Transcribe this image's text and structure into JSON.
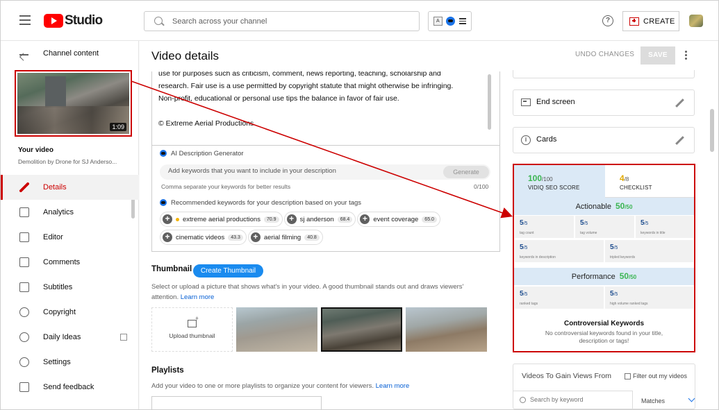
{
  "topbar": {
    "logo_text": "Studio",
    "search_placeholder": "Search across your channel",
    "create_label": "CREATE",
    "help_symbol": "?",
    "ext_a": "A"
  },
  "sidebar": {
    "back_label": "Channel content",
    "thumbnail_duration": "1:09",
    "your_video_label": "Your video",
    "video_name": "Demolition by Drone for SJ Anderso...",
    "items": [
      {
        "label": "Details",
        "icon": "pencil-icon",
        "active": true
      },
      {
        "label": "Analytics",
        "icon": "analytics-icon"
      },
      {
        "label": "Editor",
        "icon": "editor-icon"
      },
      {
        "label": "Comments",
        "icon": "comments-icon"
      },
      {
        "label": "Subtitles",
        "icon": "subtitles-icon"
      },
      {
        "label": "Copyright",
        "icon": "copyright-icon"
      },
      {
        "label": "Daily Ideas",
        "icon": "daily-ideas-icon"
      },
      {
        "label": "Settings",
        "icon": "settings-icon"
      },
      {
        "label": "Send feedback",
        "icon": "feedback-icon"
      }
    ]
  },
  "main": {
    "title": "Video details",
    "undo_label": "UNDO CHANGES",
    "save_label": "SAVE",
    "description": {
      "line1": "use  for purposes such as criticism, comment, news reporting, teaching, scholarship and",
      "line2": "research. Fair use is a use permitted by copyright statute that might otherwise be infringing.",
      "line3": "Non-profit, educational or personal use tips the balance in favor of fair use.",
      "line4": "",
      "line5": "© Extreme Aerial Productions"
    },
    "ai": {
      "title": "AI Description Generator",
      "input_placeholder": "Add keywords that you want to include in your description",
      "generate_label": "Generate",
      "hint": "Comma separate your keywords for better results",
      "count": "0/100",
      "recommended_title": "Recommended keywords for your description based on your tags",
      "keywords": [
        {
          "text": "extreme aerial productions",
          "score": "70.9",
          "dot": true
        },
        {
          "text": "sj anderson",
          "score": "68.4"
        },
        {
          "text": "event coverage",
          "score": "65.0"
        },
        {
          "text": "cinematic videos",
          "score": "43.3"
        },
        {
          "text": "aerial filming",
          "score": "40.8"
        }
      ]
    },
    "thumbnail": {
      "title": "Thumbnail",
      "create_label": "Create Thumbnail",
      "desc": "Select or upload a picture that shows what's in your video. A good thumbnail stands out and draws viewers' attention.",
      "learn_more": "Learn more",
      "upload_label": "Upload thumbnail"
    },
    "playlists": {
      "title": "Playlists",
      "desc": "Add your video to one or more playlists to organize your content for viewers.",
      "learn_more": "Learn more"
    }
  },
  "right": {
    "end_screen_label": "End screen",
    "cards_label": "Cards",
    "vidiq": {
      "seo_score": "100",
      "seo_max": "/100",
      "seo_label": "VIDIQ SEO SCORE",
      "checklist_score": "4",
      "checklist_max": "/8",
      "checklist_label": "CHECKLIST",
      "actionable_label": "Actionable",
      "actionable_score": "50",
      "actionable_max": "/50",
      "actionable_cells": [
        {
          "value": "5",
          "max": "/5",
          "label": "tag count"
        },
        {
          "value": "5",
          "max": "/5",
          "label": "tag volume"
        },
        {
          "value": "5",
          "max": "/5",
          "label": "keywords in title"
        },
        {
          "value": "5",
          "max": "/5",
          "label": "keywords in description"
        },
        {
          "value": "5",
          "max": "/5",
          "label": "tripled keywords"
        }
      ],
      "performance_label": "Performance",
      "performance_score": "50",
      "performance_max": "/50",
      "performance_cells": [
        {
          "value": "5",
          "max": "/5",
          "label": "ranked tags"
        },
        {
          "value": "5",
          "max": "/5",
          "label": "high volume ranked tags"
        }
      ],
      "controversial_title": "Controversial Keywords",
      "controversial_desc": "No controversial keywords found in your title, description or tags!"
    },
    "videos_gain": {
      "title": "Videos To Gain Views From",
      "filter_label": "Filter out my videos",
      "search_placeholder": "Search by keyword",
      "matches_label": "Matches"
    }
  },
  "colors": {
    "accent_red": "#cc0000",
    "link_blue": "#065fd4",
    "vidiq_green": "#3bb552",
    "highlight": "#cc0000"
  }
}
